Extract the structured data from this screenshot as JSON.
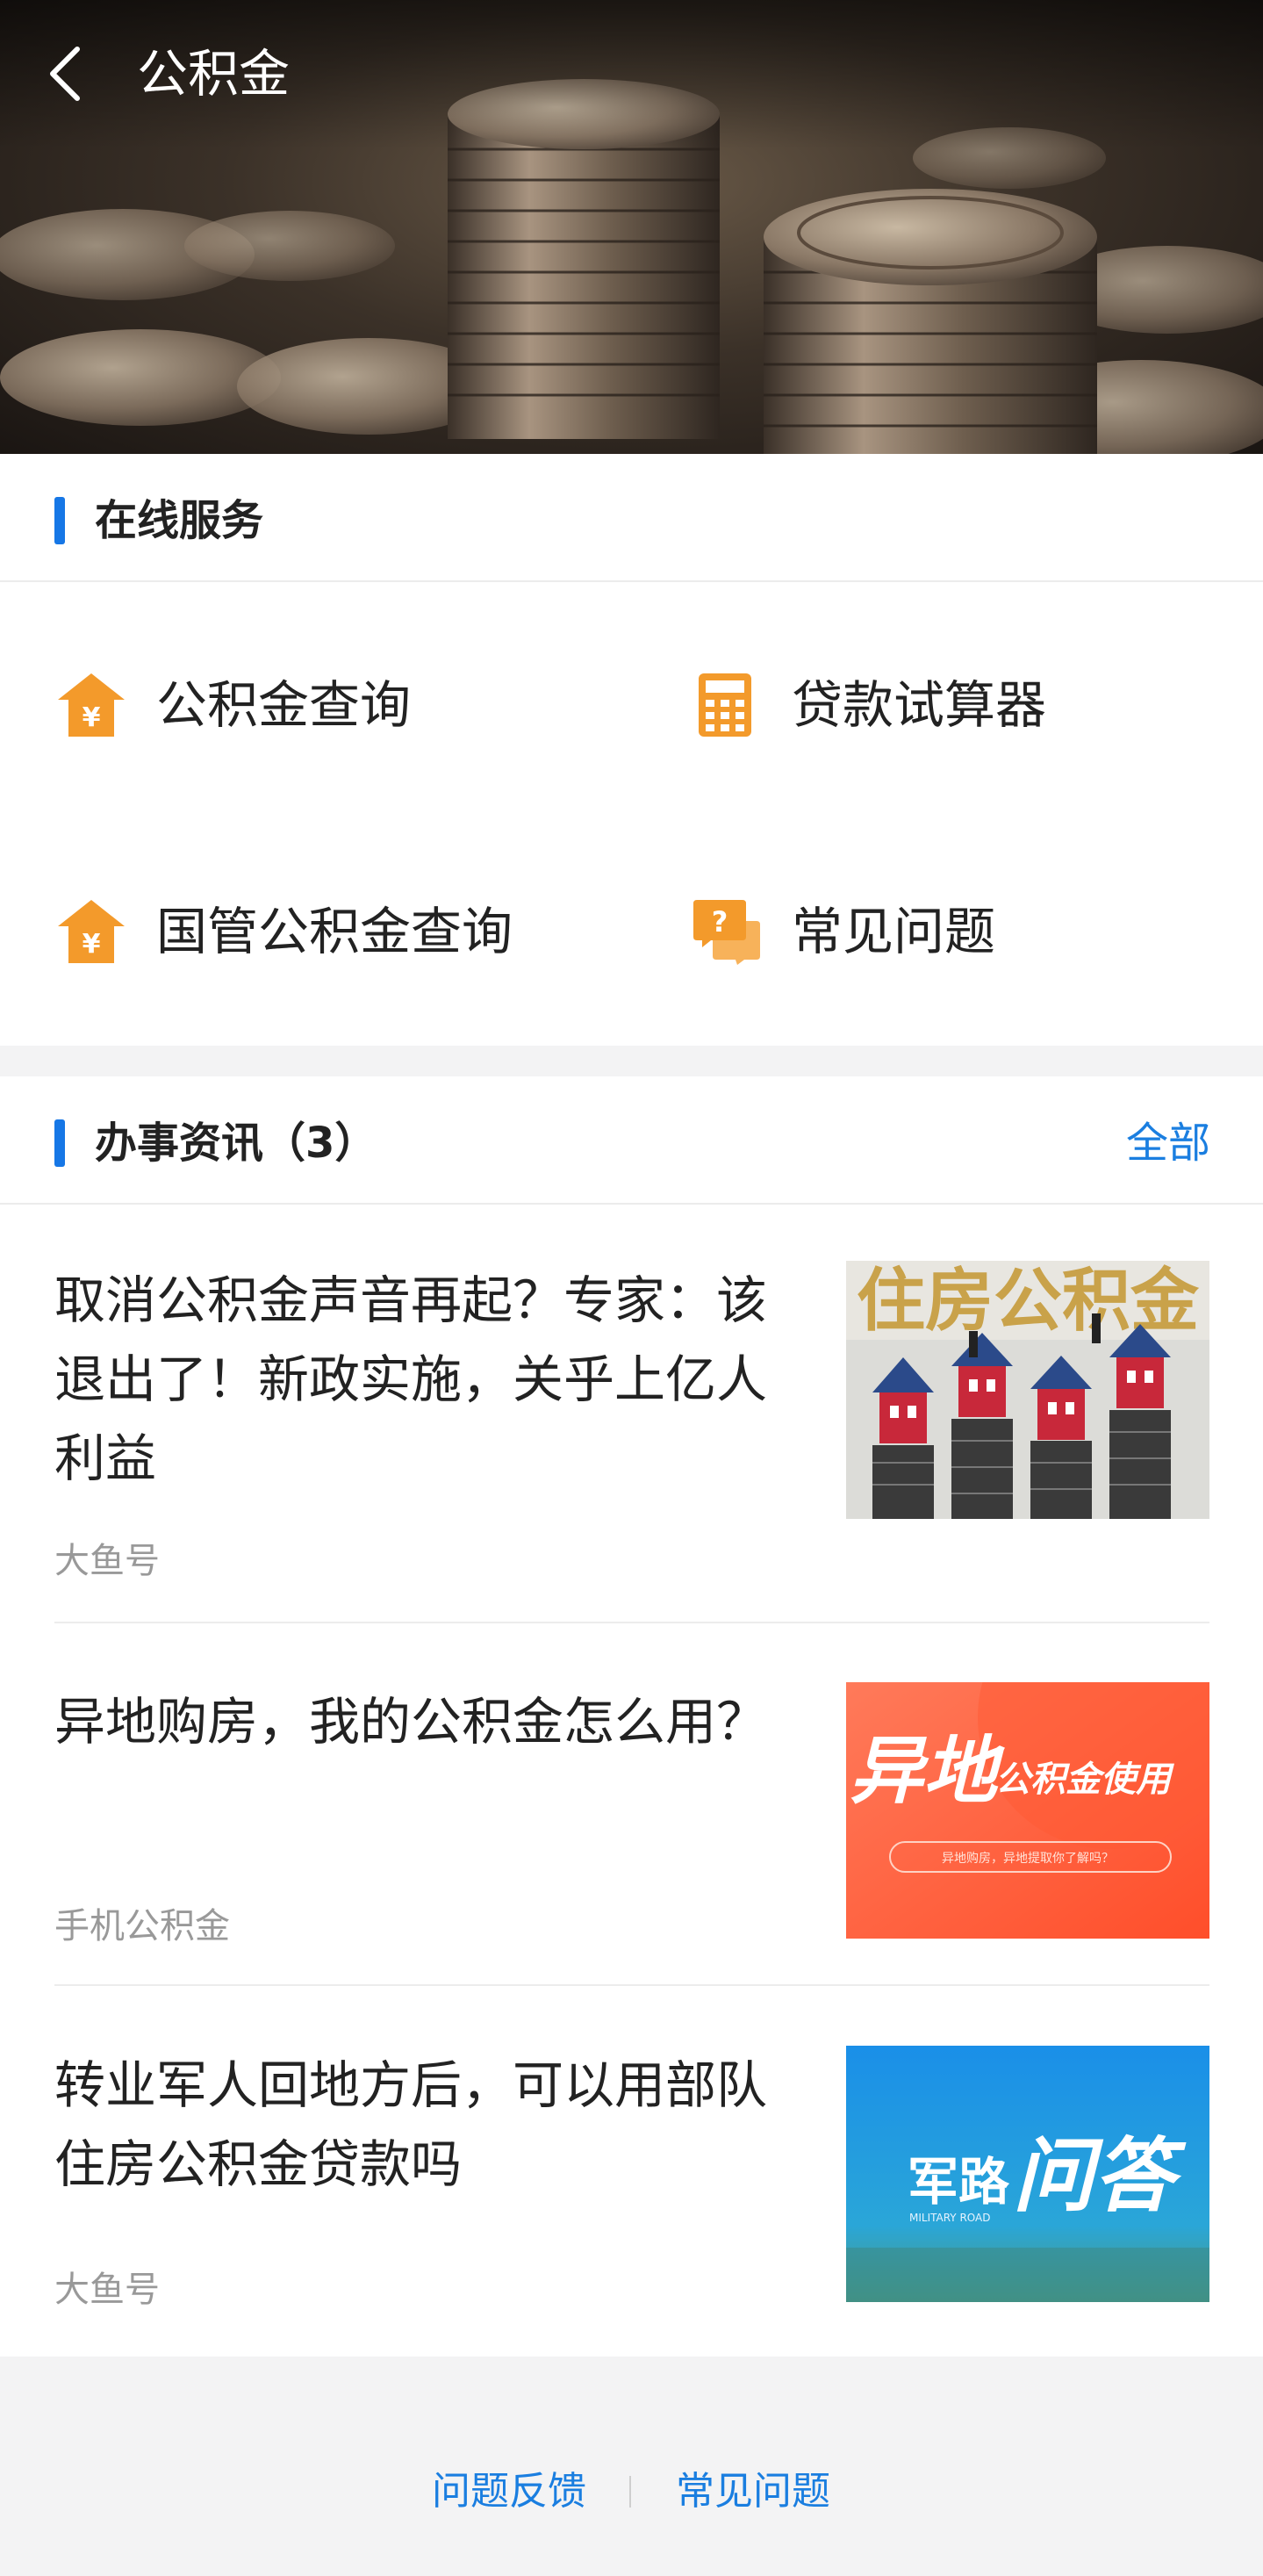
{
  "nav": {
    "title": "公积金"
  },
  "online": {
    "title": "在线服务",
    "items": [
      {
        "label": "公积金查询",
        "icon": "house-yuan-icon"
      },
      {
        "label": "贷款试算器",
        "icon": "calculator-icon"
      },
      {
        "label": "国管公积金查询",
        "icon": "house-yuan-icon"
      },
      {
        "label": "常见问题",
        "icon": "question-chat-icon"
      }
    ]
  },
  "news": {
    "title": "办事资讯（3）",
    "more": "全部",
    "items": [
      {
        "title": "取消公积金声音再起？专家：该退出了！新政实施，关乎上亿人利益",
        "source": "大鱼号",
        "thumb_text": "住房公积金"
      },
      {
        "title": "异地购房，我的公积金怎么用？",
        "source": "手机公积金",
        "thumb_text": "异地",
        "thumb_text2": "公积金使用",
        "thumb_text3": "异地购房，异地提取你了解吗？"
      },
      {
        "title": "转业军人回地方后，可以用部队住房公积金贷款吗",
        "source": "大鱼号",
        "thumb_text": "军路",
        "thumb_text2": "问答",
        "thumb_text3": "MILITARY ROAD"
      }
    ]
  },
  "footer": {
    "feedback": "问题反馈",
    "faq": "常见问题"
  },
  "colors": {
    "accent": "#1677e6",
    "link": "#1a7ee0",
    "icon_orange": "#f39a2b"
  }
}
